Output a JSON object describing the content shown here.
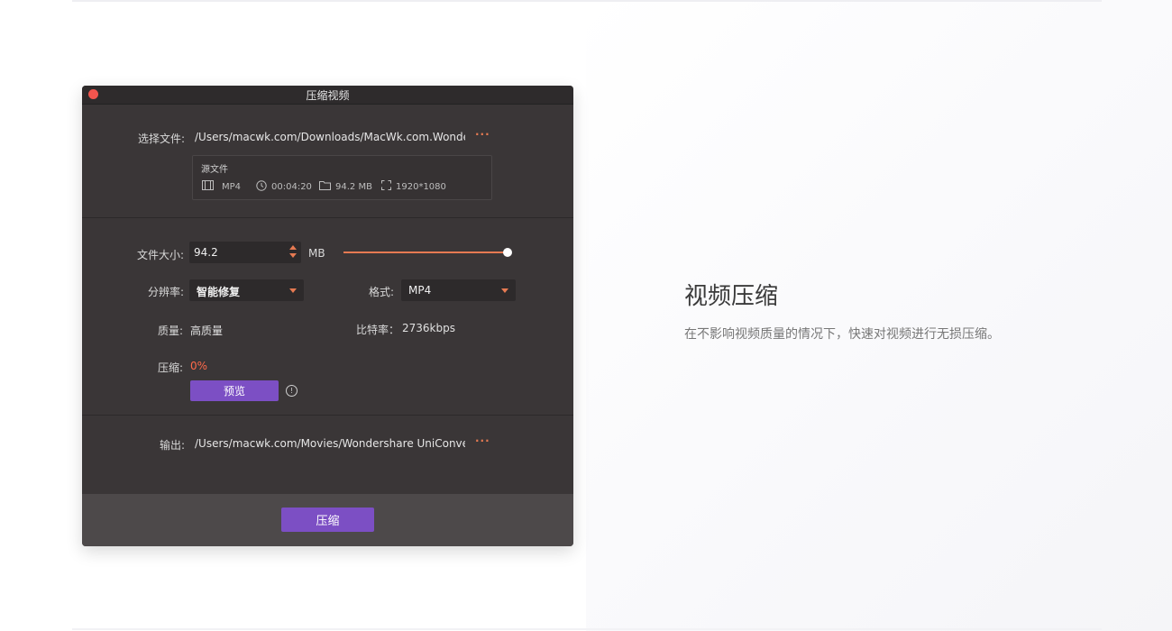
{
  "dialog": {
    "title": "压缩视频",
    "select_file_label": "选择文件:",
    "select_file_path": "/Users/macwk.com/Downloads/MacWk.com.Wonder W",
    "more_label": "···",
    "source": {
      "title": "源文件",
      "format": "MP4",
      "duration": "00:04:20",
      "size": "94.2 MB",
      "resolution": "1920*1080"
    },
    "file_size_label": "文件大小:",
    "file_size_value": "94.2",
    "file_size_unit": "MB",
    "file_size_slider_fraction": 1.0,
    "resolution_label": "分辨率:",
    "resolution_value": "智能修复",
    "format_label": "格式:",
    "format_value": "MP4",
    "quality_label": "质量:",
    "quality_value": "高质量",
    "bitrate_label": "比特率：",
    "bitrate_value": "2736kbps",
    "compress_label": "压缩:",
    "compress_value": "0%",
    "preview_button": "预览",
    "output_label": "输出:",
    "output_path": "/Users/macwk.com/Movies/Wondershare UniConverter",
    "compress_button": "压缩"
  },
  "feature": {
    "heading": "视频压缩",
    "description": "在不影响视频质量的情况下，快速对视频进行无损压缩。"
  },
  "colors": {
    "accent": "#e67a52",
    "button": "#7c4fc4",
    "window_bg": "#3a3637"
  }
}
